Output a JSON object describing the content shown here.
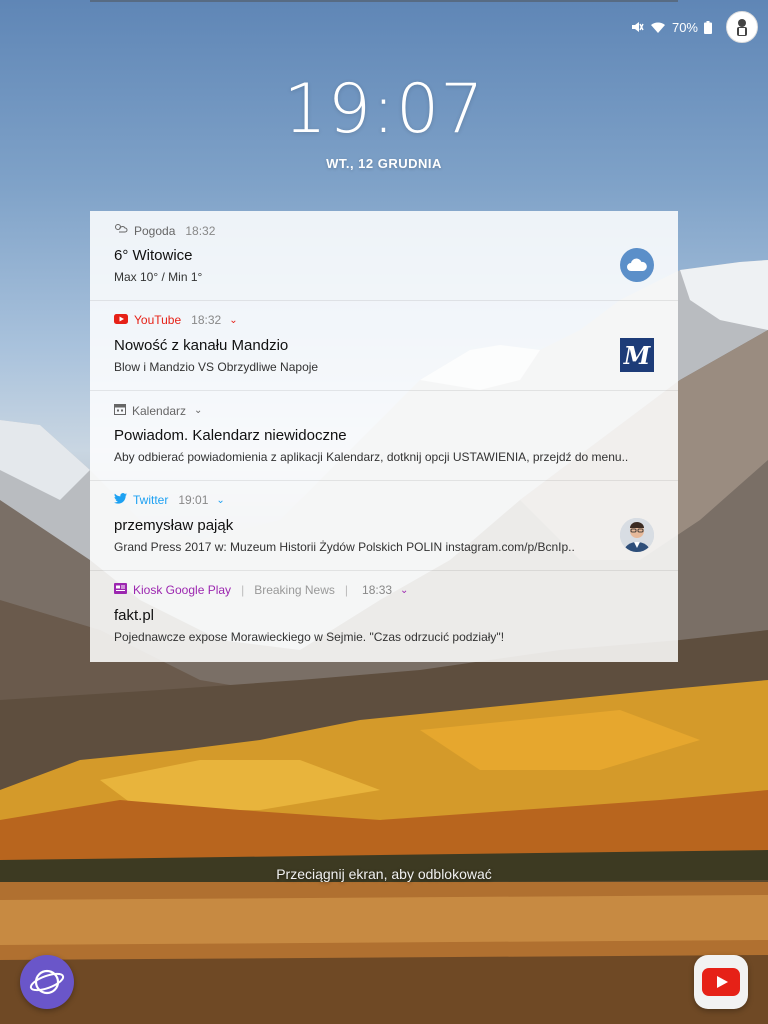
{
  "status_bar": {
    "mute_icon": "mute-icon",
    "wifi_icon": "wifi-icon",
    "battery_percent": "70%",
    "battery_icon": "battery-icon",
    "avatar_icon": "profile-avatar-icon"
  },
  "clock": {
    "time": "19:07",
    "date": "WT., 12 GRUDNIA"
  },
  "notifications": [
    {
      "app": "Pogoda",
      "time": "18:32",
      "app_color": "#555555",
      "icon": "weather-icon",
      "title": "6° Witowice",
      "body": "Max 10° / Min 1°",
      "thumbnail": "cloud-icon"
    },
    {
      "app": "YouTube",
      "time": "18:32",
      "app_color": "#e62117",
      "icon": "youtube-icon",
      "title": "Nowość z kanału Mandzio",
      "body": "Blow i Mandzio VS Obrzydliwe Napoje",
      "thumbnail": "channel-logo-m"
    },
    {
      "app": "Kalendarz",
      "time": "",
      "app_color": "#555555",
      "icon": "calendar-icon",
      "title": "Powiadom. Kalendarz niewidoczne",
      "body": "Aby odbierać powiadomienia z aplikacji Kalendarz, dotknij opcji USTAWIENIA, przejdź do menu..",
      "thumbnail": ""
    },
    {
      "app": "Twitter",
      "time": "19:01",
      "app_color": "#1da1f2",
      "icon": "twitter-icon",
      "title": "przemysław pająk",
      "body": "Grand Press 2017 w: Muzeum Historii Żydów Polskich POLIN instagram.com/p/BcnIp..",
      "thumbnail": "user-avatar"
    },
    {
      "app": "Kiosk Google Play",
      "extra": "Breaking News",
      "time": "18:33",
      "app_color": "#9c27b0",
      "icon": "newsstand-icon",
      "title": "fakt.pl",
      "body": "Pojednawcze expose Morawieckiego w Sejmie. \"Czas odrzucić podziały\"!",
      "thumbnail": ""
    }
  ],
  "unlock_hint": "Przeciągnij ekran, aby odblokować",
  "shortcuts": {
    "left_icon": "samsung-internet-icon",
    "right_icon": "youtube-app-icon"
  },
  "colors": {
    "youtube_red": "#e62117",
    "twitter_blue": "#1da1f2",
    "kiosk_purple": "#9c27b0",
    "weather_blue": "#5b8fc9"
  }
}
